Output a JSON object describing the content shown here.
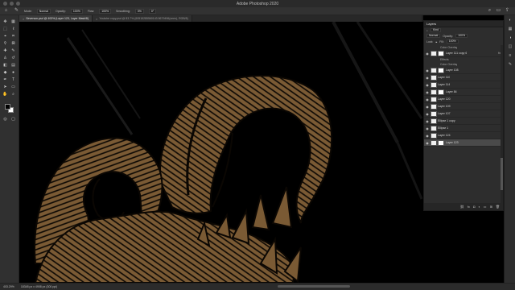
{
  "window": {
    "title": "Adobe Photoshop 2020"
  },
  "options_bar": {
    "mode_label": "Mode:",
    "mode_value": "Normal",
    "opacity_label": "Opacity:",
    "opacity_value": "100%",
    "flow_label": "Flow:",
    "flow_value": "100%",
    "smoothing_label": "Smoothing:",
    "smoothing_value": "0%",
    "angle_value": "0°"
  },
  "tabs": [
    {
      "label": "Severson.psd @ 403% (Layer 123, Layer Mask/8)",
      "active": true
    },
    {
      "label": "Youtube copy.psd @ 83.7% (60515285560143.5679496(xeen), RGB/8)",
      "active": false
    }
  ],
  "status": {
    "zoom": "403.29%",
    "doc_size": "18348 px x 4908 px (300 ppi)"
  },
  "layers_panel": {
    "title": "Layers",
    "filter_label": "Kind",
    "blend_mode": "Normal",
    "opacity_label": "Opacity:",
    "opacity_value": "100%",
    "lock_label": "Lock:",
    "fill_label": "Fill:",
    "fill_value": "100%",
    "rows": [
      {
        "type": "sub",
        "name": "Color Overlay"
      },
      {
        "type": "layer",
        "name": "Layer 111 copy 6",
        "mask": true,
        "fx": true
      },
      {
        "type": "sub",
        "name": "Effects"
      },
      {
        "type": "sub",
        "name": "Color Overlay"
      },
      {
        "type": "layer",
        "name": "Layer 108",
        "mask": true
      },
      {
        "type": "layer",
        "name": "Layer 110"
      },
      {
        "type": "layer",
        "name": "Layer 114"
      },
      {
        "type": "layer",
        "name": "Layer 84",
        "mask": true
      },
      {
        "type": "layer",
        "name": "Layer 120"
      },
      {
        "type": "layer",
        "name": "Layer 109"
      },
      {
        "type": "layer",
        "name": "Layer 107"
      },
      {
        "type": "layer",
        "name": "Ellipse 1 copy"
      },
      {
        "type": "layer",
        "name": "Ellipse 1"
      },
      {
        "type": "layer",
        "name": "Layer 124"
      },
      {
        "type": "layer",
        "name": "Layer 123",
        "mask": true,
        "selected": true
      }
    ],
    "footer_icons": [
      "link-icon",
      "fx-icon",
      "mask-icon",
      "adjustment-icon",
      "folder-icon",
      "new-layer-icon",
      "trash-icon"
    ]
  },
  "colors": {
    "artwork_fill": "#7a5a34",
    "artwork_line": "#0b0703",
    "canvas": "#000000"
  }
}
